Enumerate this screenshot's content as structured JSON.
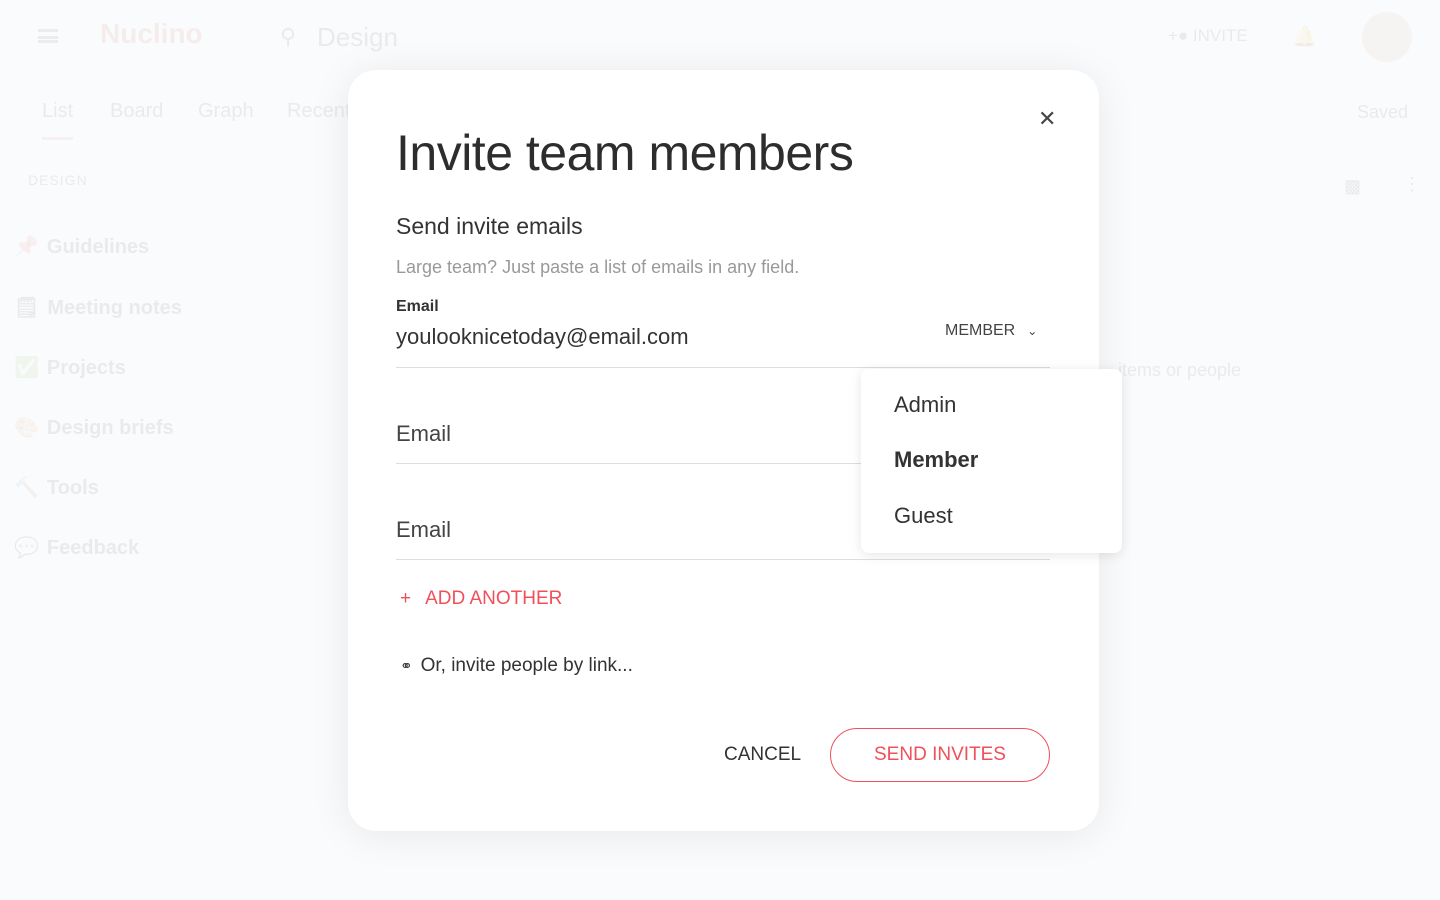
{
  "background": {
    "logo": "Nuclino",
    "search": "Design",
    "tabs": [
      "List",
      "Board",
      "Graph",
      "Recent"
    ],
    "section": "DESIGN",
    "items": [
      {
        "icon": "pin-icon",
        "label": "Guidelines"
      },
      {
        "icon": "notepad-icon",
        "label": "Meeting notes"
      },
      {
        "icon": "check-icon",
        "label": "Projects"
      },
      {
        "icon": "palette-icon",
        "label": "Design briefs"
      },
      {
        "icon": "hammer-icon",
        "label": "Tools"
      },
      {
        "icon": "speech-icon",
        "label": "Feedback"
      }
    ],
    "invite": "INVITE",
    "saved": "Saved",
    "mention": "items or people"
  },
  "modal": {
    "title": "Invite team members",
    "subtitle": "Send invite emails",
    "hint": "Large team? Just paste a list of emails in any field.",
    "email_label": "Email",
    "email_value": "youlooknicetoday@email.com",
    "email_placeholder": "Email",
    "role": "MEMBER",
    "role_options": [
      "Admin",
      "Member",
      "Guest"
    ],
    "selected_role": "Member",
    "add_another": "ADD ANOTHER",
    "invite_link": "Or, invite people by link...",
    "cancel": "CANCEL",
    "send": "SEND INVITES"
  },
  "colors": {
    "accent": "#f0505a"
  }
}
